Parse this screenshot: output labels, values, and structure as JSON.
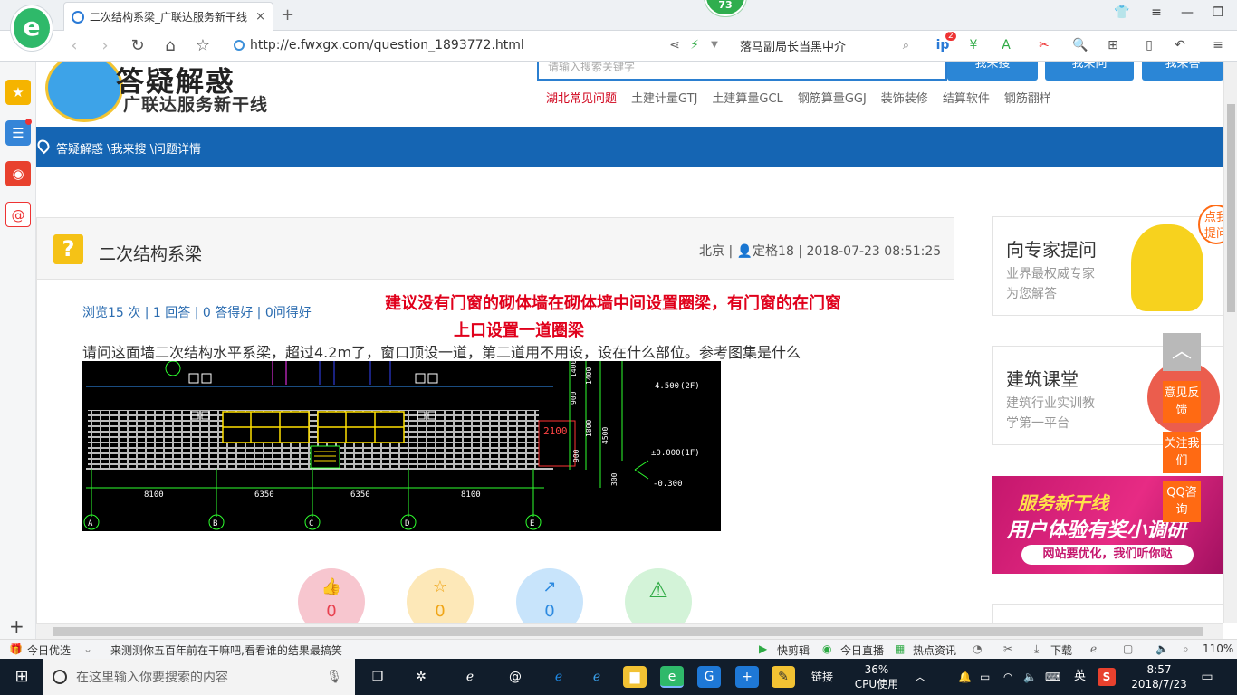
{
  "browser": {
    "logo": "e",
    "tab_title": "二次结构系梁_广联达服务新干线",
    "tab_close": "×",
    "new_tab": "+",
    "badge": "73",
    "url": "http://e.fwxgx.com/question_1893772.html",
    "search_text": "落马副局长当黑中介",
    "ext_badge": "2"
  },
  "site": {
    "logo_title": "答疑解惑",
    "logo_sub": "广联达服务新干线",
    "search_placeholder": "请输入搜索关键字",
    "btn_search": "我来搜",
    "btn_ask": "我来问",
    "btn_answer": "我来答",
    "categories": [
      "湖北常见问题",
      "土建计量GTJ",
      "土建算量GCL",
      "钢筋算量GGJ",
      "装饰装修",
      "结算软件",
      "钢筋翻样"
    ],
    "breadcrumb": "答疑解惑 \\我来搜 \\问题详情"
  },
  "question": {
    "icon": "?",
    "title": "二次结构系梁",
    "meta": "北京 | 👤定格18 | 2018-07-23 08:51:25",
    "stats": "浏览15 次 | 1 回答 | 0 答得好 | 0问得好",
    "answer_line1": "建议没有门窗的砌体墙在砌体墙中间设置圈梁，有门窗的在门窗",
    "answer_line2": "上口设置一道圈梁",
    "body": "请问这面墙二次结构水平系梁，超过4.2m了，窗口顶设一道，第二道用不用设，设在什么部位。参考图集是什么",
    "reactions": [
      {
        "icon": "👍",
        "count": "0",
        "color": "#f7c6cf",
        "text_color": "#e8414f"
      },
      {
        "icon": "☆",
        "count": "0",
        "color": "#fde8b8",
        "text_color": "#f0a516"
      },
      {
        "icon": "↗",
        "count": "0",
        "color": "#c8e4fb",
        "text_color": "#2d8ae0"
      },
      {
        "icon": "⚠",
        "count": "",
        "color": "#d3f3d8",
        "text_color": "#2eaa44"
      }
    ]
  },
  "cad": {
    "dims": [
      "8100",
      "6350",
      "6350",
      "8100"
    ],
    "axes": [
      "A",
      "B",
      "C",
      "D",
      "E"
    ],
    "window_label": "2100",
    "elev_labels": [
      "4.500",
      "(2F)",
      "±0.000",
      "(1F)",
      "-0.300"
    ],
    "vert_dims": [
      "1400",
      "900",
      "1400",
      "4500",
      "1800",
      "900",
      "300"
    ]
  },
  "sidebar_right": {
    "expert_title": "向专家提问",
    "expert_sub1": "业界最权威专家",
    "expert_sub2": "为您解答",
    "expert_tag": "点我提问",
    "class_title": "建筑课堂",
    "class_sub1": "建筑行业实训教",
    "class_sub2": "学第一平台",
    "promo_1": "服务新干线",
    "promo_2": "用户体验有奖小调研",
    "promo_3": "网站要优化，我们听你哒"
  },
  "float_btns": {
    "top": "︿",
    "feedback": "意见反馈",
    "follow": "关注我们",
    "qq": "QQ咨询"
  },
  "statusbar": {
    "left1": "今日优选",
    "left2": "来测测你五百年前在干嘛吧,看看谁的结果最搞笑",
    "items": [
      "快剪辑",
      "今日直播",
      "热点资讯",
      "下载"
    ],
    "zoom": "110%"
  },
  "taskbar": {
    "search_placeholder": "在这里输入你要搜索的内容",
    "links": "链接",
    "cpu_pct": "36%",
    "cpu_label": "CPU使用",
    "ime": "英",
    "time": "8:57",
    "date": "2018/7/23"
  }
}
